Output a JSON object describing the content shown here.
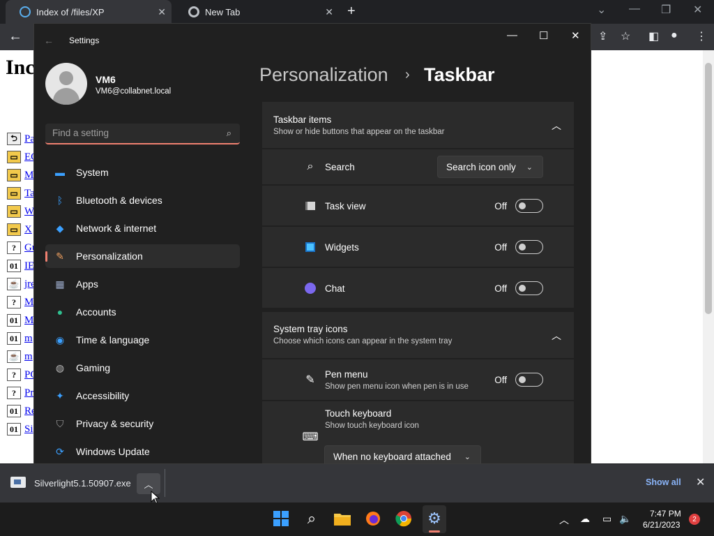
{
  "browser": {
    "tabs": [
      {
        "label": "Index of /files/XP"
      },
      {
        "label": "New Tab"
      }
    ],
    "new_tab": "+",
    "page": {
      "heading": "Inc",
      "rows": [
        {
          "icon": "back-arrow",
          "text": "Pa"
        },
        {
          "icon": "folder",
          "text": "EC"
        },
        {
          "icon": "folder",
          "text": "M"
        },
        {
          "icon": "folder",
          "text": "Ta"
        },
        {
          "icon": "folder",
          "text": "W"
        },
        {
          "icon": "folder",
          "text": "X"
        },
        {
          "icon": "unknown",
          "text": "Gu"
        },
        {
          "icon": "binary",
          "text": "IE"
        },
        {
          "icon": "java",
          "text": "jre"
        },
        {
          "icon": "unknown",
          "text": "M"
        },
        {
          "icon": "binary",
          "text": "M"
        },
        {
          "icon": "binary",
          "text": "m"
        },
        {
          "icon": "java",
          "text": "m"
        },
        {
          "icon": "unknown",
          "text": "PC"
        },
        {
          "icon": "unknown",
          "text": "Pr"
        },
        {
          "icon": "binary",
          "text": "Re"
        },
        {
          "icon": "binary",
          "text": "Si"
        }
      ]
    }
  },
  "settings": {
    "window_title": "Settings",
    "user": {
      "name": "VM6",
      "email": "VM6@collabnet.local"
    },
    "search": {
      "placeholder": "Find a setting"
    },
    "nav": [
      {
        "label": "System",
        "icon": "monitor-icon",
        "active": false
      },
      {
        "label": "Bluetooth & devices",
        "icon": "bluetooth-icon",
        "active": false
      },
      {
        "label": "Network & internet",
        "icon": "wifi-icon",
        "active": false
      },
      {
        "label": "Personalization",
        "icon": "brush-icon",
        "active": true
      },
      {
        "label": "Apps",
        "icon": "apps-icon",
        "active": false
      },
      {
        "label": "Accounts",
        "icon": "person-icon",
        "active": false
      },
      {
        "label": "Time & language",
        "icon": "globe-clock-icon",
        "active": false
      },
      {
        "label": "Gaming",
        "icon": "gamepad-icon",
        "active": false
      },
      {
        "label": "Accessibility",
        "icon": "accessibility-icon",
        "active": false
      },
      {
        "label": "Privacy & security",
        "icon": "shield-icon",
        "active": false
      },
      {
        "label": "Windows Update",
        "icon": "update-icon",
        "active": false
      }
    ],
    "breadcrumb": {
      "parent": "Personalization",
      "separator": "›",
      "current": "Taskbar"
    },
    "taskbar_items": {
      "title": "Taskbar items",
      "subtitle": "Show or hide buttons that appear on the taskbar",
      "rows": [
        {
          "label": "Search",
          "control": "dropdown",
          "value": "Search icon only"
        },
        {
          "label": "Task view",
          "control": "toggle",
          "state": "Off"
        },
        {
          "label": "Widgets",
          "control": "toggle",
          "state": "Off"
        },
        {
          "label": "Chat",
          "control": "toggle",
          "state": "Off"
        }
      ]
    },
    "system_tray": {
      "title": "System tray icons",
      "subtitle": "Choose which icons can appear in the system tray",
      "pen": {
        "label": "Pen menu",
        "desc": "Show pen menu icon when pen is in use",
        "state": "Off"
      },
      "keyboard": {
        "label": "Touch keyboard",
        "desc": "Show touch keyboard icon",
        "value": "When no keyboard attached"
      }
    }
  },
  "downloads": {
    "file": "Silverlight5.1.50907.exe",
    "show_all": "Show all"
  },
  "taskbar": {
    "time": "7:47 PM",
    "date": "6/21/2023",
    "notifications": "2"
  },
  "colors": {
    "accent": "#f08070",
    "window_bg": "#202020",
    "card_bg": "#2b2b2b",
    "link": "#8ab4f8"
  }
}
